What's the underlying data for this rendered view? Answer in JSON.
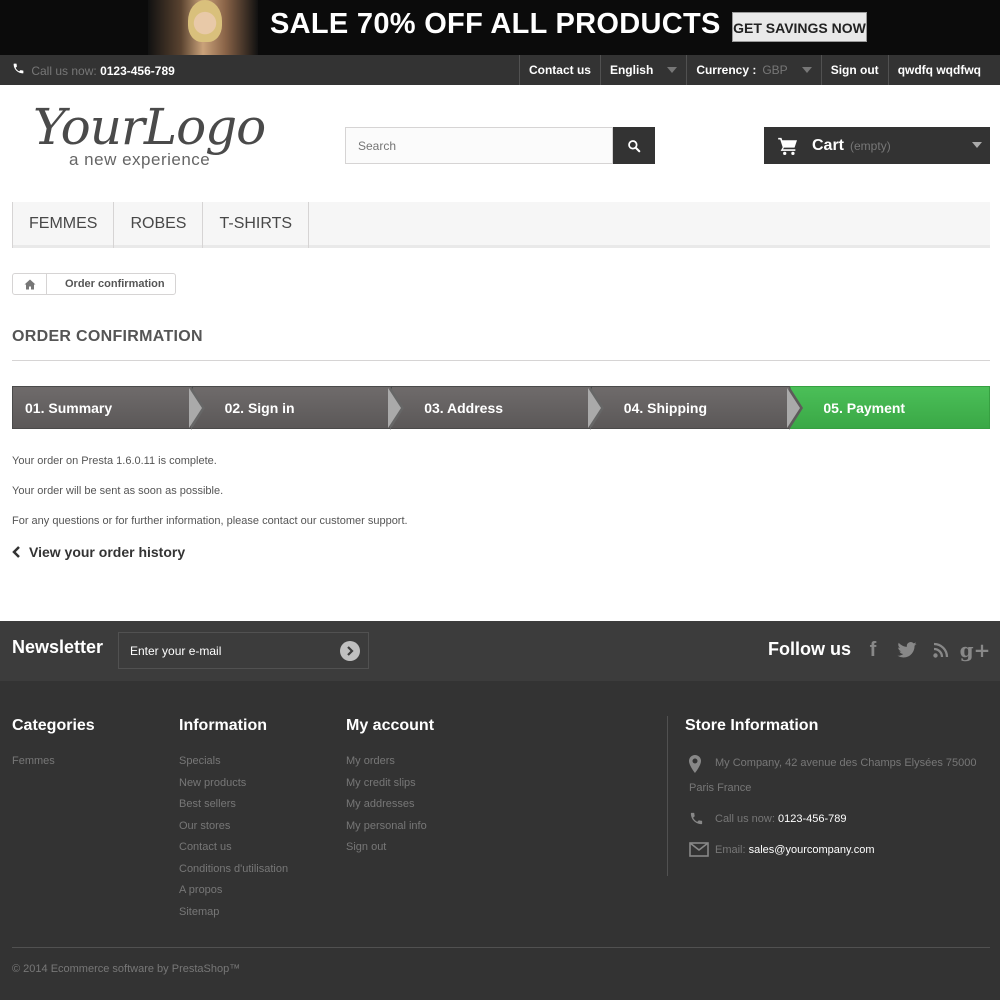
{
  "banner": {
    "text": "SALE 70% OFF ALL PRODUCTS",
    "button": "GET SAVINGS NOW"
  },
  "topnav": {
    "call_prefix": "Call us now:",
    "phone": "0123-456-789",
    "contact": "Contact us",
    "language": "English",
    "currency_label": "Currency :",
    "currency_value": "GBP",
    "signout": "Sign out",
    "user": "qwdfq wqdfwq"
  },
  "header": {
    "logo_main": "YourLogo",
    "logo_sub": "a new experience",
    "search_placeholder": "Search",
    "cart_label": "Cart",
    "cart_status": "(empty)"
  },
  "menu": [
    "Femmes",
    "Robes",
    "T-shirts"
  ],
  "breadcrumb": "Order confirmation",
  "page_title": "Order confirmation",
  "steps": [
    "01. Summary",
    "02. Sign in",
    "03. Address",
    "04. Shipping",
    "05. Payment"
  ],
  "messages": [
    "Your order on Presta 1.6.0.11 is complete.",
    "Your order will be sent as soon as possible.",
    "For any questions or for further information, please contact our customer support."
  ],
  "history_link": "View your order history",
  "newsletter": {
    "title": "Newsletter",
    "placeholder": "Enter your e-mail",
    "follow": "Follow us"
  },
  "footer": {
    "categories": {
      "title": "Categories",
      "items": [
        "Femmes"
      ]
    },
    "information": {
      "title": "Information",
      "items": [
        "Specials",
        "New products",
        "Best sellers",
        "Our stores",
        "Contact us",
        "Conditions d'utilisation",
        "A propos",
        "Sitemap"
      ]
    },
    "account": {
      "title": "My account",
      "items": [
        "My orders",
        "My credit slips",
        "My addresses",
        "My personal info",
        "Sign out"
      ]
    },
    "store": {
      "title": "Store Information",
      "address_line1": "My Company, 42 avenue des Champs Elysées 75000",
      "address_line2": "Paris France",
      "call_prefix": "Call us now:",
      "phone": "0123-456-789",
      "email_prefix": "Email:",
      "email": "sales@yourcompany.com"
    },
    "copyright": "© 2014 Ecommerce software by PrestaShop™"
  },
  "colors": {
    "dark": "#333333",
    "active_step": "#46b653",
    "footer": "#333333",
    "newsletter_bar": "#3c3c3c"
  }
}
